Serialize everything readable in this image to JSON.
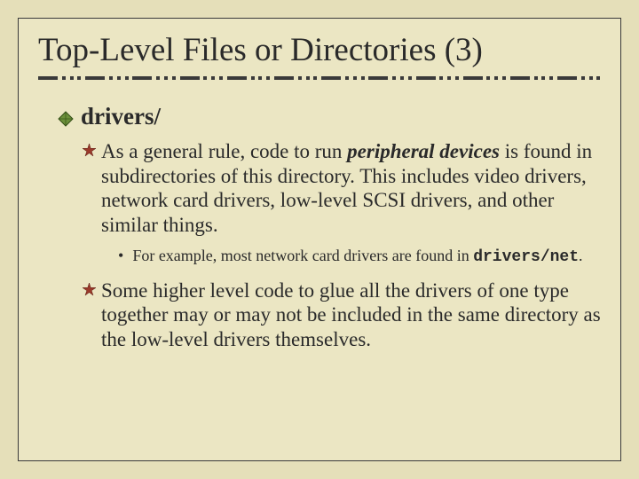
{
  "title": "Top-Level Files or Directories (3)",
  "level1": {
    "text": "drivers/"
  },
  "level2a": {
    "pre": "As a general rule, code to run ",
    "emph": "peripheral devices",
    "post": " is found in subdirectories of this directory. This includes video drivers, network card drivers, low-level SCSI drivers, and other similar things."
  },
  "level3": {
    "pre": "For example, most network card drivers are found in ",
    "code": "drivers/net",
    "post": "."
  },
  "level2b": {
    "text": "Some higher level code to glue all the drivers of one type together may or may not be included in the same directory as the low-level drivers themselves."
  }
}
